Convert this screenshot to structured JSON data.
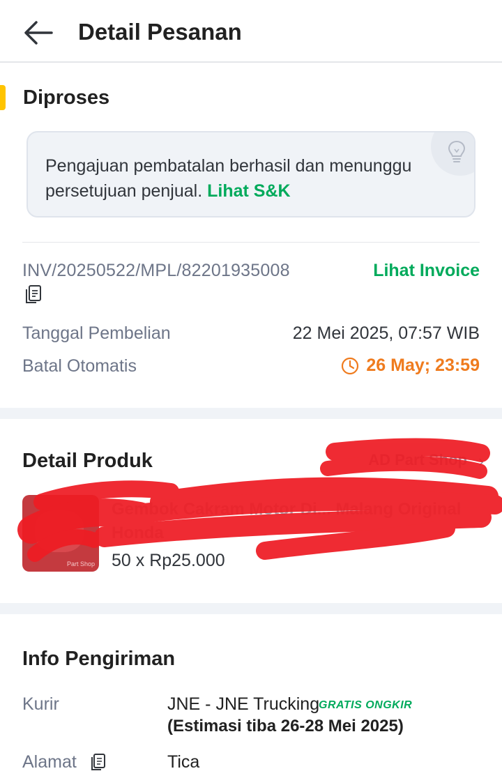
{
  "header": {
    "title": "Detail Pesanan",
    "back_icon": "arrow-left-icon"
  },
  "status": {
    "label": "Diproses",
    "accent": "#ffc400"
  },
  "notice": {
    "text": "Pengajuan pembatalan berhasil dan menunggu persetujuan penjual.",
    "link": "Lihat S&K",
    "icon": "lightbulb-icon"
  },
  "invoice": {
    "number": "INV/20250522/MPL/82201935008",
    "copy_icon": "copy-icon",
    "link": "Lihat Invoice"
  },
  "details": {
    "purchase_date_label": "Tanggal Pembelian",
    "purchase_date_value": "22 Mei 2025, 07:57 WIB",
    "auto_cancel_label": "Batal Otomatis",
    "auto_cancel_value": "26 May; 23:59",
    "clock_icon": "clock-icon"
  },
  "product": {
    "section_title": "Detail Produk",
    "shop_name": "AD Part Shop",
    "chevron_icon": "chevron-right-icon",
    "name": "Gembok Cakram Motor Di... Malang Original Honda",
    "quantity_price": "50 x Rp25.000"
  },
  "shipping": {
    "section_title": "Info Pengiriman",
    "courier_label": "Kurir",
    "courier_value": "JNE - JNE Trucking",
    "free_shipping_badge": "GRATIS ONGKIR",
    "estimate": "(Estimasi tiba 26-28 Mei 2025)",
    "address_label": "Alamat",
    "address_icon": "copy-icon",
    "recipient": "Tica"
  },
  "colors": {
    "green": "#00aa5b",
    "orange": "#ef7b1e",
    "redaction": "#ee1c24"
  }
}
